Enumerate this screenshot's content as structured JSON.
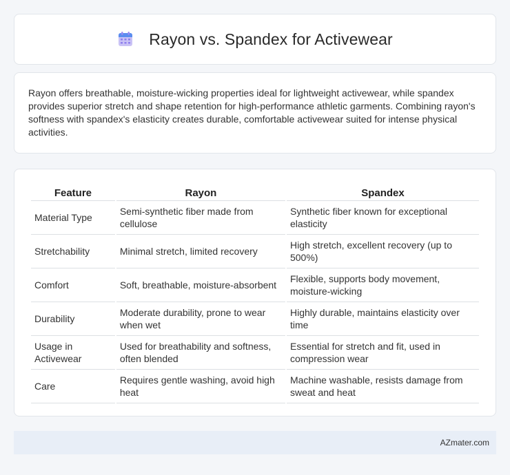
{
  "header": {
    "title": "Rayon vs. Spandex for Activewear",
    "icon": "calendar-icon",
    "icon_color": "#7b68ee"
  },
  "summary": {
    "text": "Rayon offers breathable, moisture-wicking properties ideal for lightweight activewear, while spandex provides superior stretch and shape retention for high-performance athletic garments. Combining rayon's softness with spandex's elasticity creates durable, comfortable activewear suited for intense physical activities."
  },
  "table": {
    "headers": [
      "Feature",
      "Rayon",
      "Spandex"
    ],
    "rows": [
      [
        "Material Type",
        "Semi-synthetic fiber made from cellulose",
        "Synthetic fiber known for exceptional elasticity"
      ],
      [
        "Stretchability",
        "Minimal stretch, limited recovery",
        "High stretch, excellent recovery (up to 500%)"
      ],
      [
        "Comfort",
        "Soft, breathable, moisture-absorbent",
        "Flexible, supports body movement, moisture-wicking"
      ],
      [
        "Durability",
        "Moderate durability, prone to wear when wet",
        "Highly durable, maintains elasticity over time"
      ],
      [
        "Usage in Activewear",
        "Used for breathability and softness, often blended",
        "Essential for stretch and fit, used in compression wear"
      ],
      [
        "Care",
        "Requires gentle washing, avoid high heat",
        "Machine washable, resists damage from sweat and heat"
      ]
    ]
  },
  "footer": {
    "brand": "AZmater.com"
  }
}
